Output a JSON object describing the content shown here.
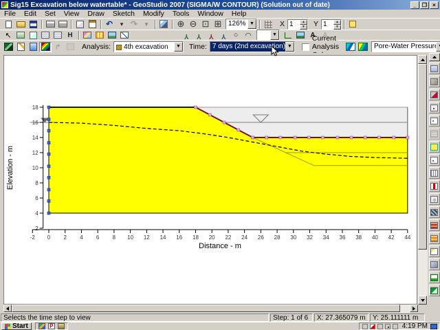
{
  "window": {
    "title": "Sig15  Excavation below watertable* - GeoStudio 2007 (SIGMA/W CONTOUR) (Solution out of date)",
    "minimize": "_",
    "restore": "❐",
    "close": "×"
  },
  "menu": [
    "File",
    "Edit",
    "Set",
    "View",
    "Draw",
    "Sketch",
    "Modify",
    "Tools",
    "Window",
    "Help"
  ],
  "toolbar_main": {
    "row1a": [
      "new",
      "open",
      "save",
      "|",
      "print",
      "print-preview",
      "|",
      "copy",
      "paste",
      "|",
      "undo",
      "undo-dropdown",
      "redo-disabled",
      "redo-dropdown-disabled",
      "|",
      "modify-objects",
      "|",
      "zoom-in",
      "zoom-out",
      "zoom-window",
      "zoom-page"
    ],
    "zoom_value": "126%",
    "row1b": [
      "grid"
    ],
    "x_label": "X",
    "x_value": "1",
    "y_label": "Y",
    "y_value": "1",
    "row1c": [
      "snap-grid"
    ]
  },
  "toolbar_edit": {
    "row2a": [
      "select",
      "select-picture",
      "copy-picture",
      "view-tables",
      "view-tables-2",
      "hatch-fill",
      "|",
      "draw-graph",
      "mesh-properties",
      "insert-picture",
      "view-result-graph"
    ],
    "row2b": [
      "draw-nodes",
      "draw-pins",
      "draw-fixity",
      "draw-loads",
      "draw-circle",
      "draw-arc"
    ],
    "row2c": [
      "sketch-axes",
      "modify-picture",
      "sketch-text",
      "sketch-text-edit-disabled"
    ]
  },
  "toolbar_analysis": {
    "row3a": [
      "geostudio-home",
      "define",
      "solve",
      "contour",
      "back-disabled",
      "delete-disabled"
    ],
    "analysis_label": "Analysis:",
    "analysis_value": "4th excavation",
    "time_label": "Time:",
    "time_value": "7 days (2nd excavation)",
    "checkbox_label": "Current Analysis Only",
    "row3b": [
      "draw-contours",
      "contour-labels"
    ],
    "parameter_value": "Pore-Water Pressure"
  },
  "chart_data": {
    "type": "area",
    "title": "",
    "xlabel": "Distance - m",
    "ylabel": "Elevation - m",
    "xlim": [
      -2,
      44
    ],
    "ylim": [
      2,
      18
    ],
    "x_ticks": [
      -2,
      0,
      2,
      4,
      6,
      8,
      10,
      12,
      14,
      16,
      18,
      20,
      22,
      24,
      26,
      28,
      30,
      32,
      34,
      36,
      38,
      40,
      42,
      44
    ],
    "y_ticks": [
      2,
      4,
      6,
      8,
      10,
      12,
      14,
      16,
      18
    ],
    "soil_region": [
      [
        0,
        4
      ],
      [
        0,
        18
      ],
      [
        18,
        18
      ],
      [
        25,
        14
      ],
      [
        44,
        14
      ],
      [
        44,
        4
      ]
    ],
    "excavated_region": [
      [
        18,
        18
      ],
      [
        44,
        18
      ],
      [
        44,
        14
      ],
      [
        25,
        14
      ]
    ],
    "ground_line": [
      [
        0,
        18
      ],
      [
        18,
        18
      ]
    ],
    "slope_line": [
      [
        18,
        18
      ],
      [
        25,
        14
      ]
    ],
    "base_line": [
      [
        25,
        14
      ],
      [
        44,
        14
      ]
    ],
    "future_excavation_lines": [
      [
        [
          25,
          14
        ],
        [
          32.5,
          10.3
        ]
      ],
      [
        [
          29,
          12
        ],
        [
          44,
          12
        ]
      ],
      [
        [
          32.5,
          10.3
        ],
        [
          44,
          10.3
        ]
      ]
    ],
    "initial_water_line": [
      [
        -2.3,
        16
      ],
      [
        0.7,
        16
      ]
    ],
    "water_table_dashed": [
      [
        0,
        16
      ],
      [
        4,
        15.9
      ],
      [
        8,
        15.6
      ],
      [
        12,
        15.2
      ],
      [
        16,
        14.9
      ],
      [
        19,
        14.5
      ],
      [
        22,
        14
      ],
      [
        25,
        13.4
      ],
      [
        28,
        12.8
      ],
      [
        31,
        12.2
      ],
      [
        34,
        11.8
      ],
      [
        37,
        11.5
      ],
      [
        40,
        11.35
      ],
      [
        44,
        11.25
      ]
    ],
    "excavation_water_line": [
      [
        21.5,
        16
      ],
      [
        44,
        16
      ]
    ],
    "water_symbols": [
      {
        "x": -0.5,
        "y": 16,
        "w": 10,
        "h": 6,
        "filled": true
      },
      {
        "x": 26,
        "y": 16,
        "w": 22,
        "h": 11,
        "filled": false
      }
    ],
    "left_boundary_markers": {
      "x": 0,
      "elevations": [
        4,
        5.6,
        7.1,
        8.7,
        10.2,
        11.8,
        13.3,
        14.9,
        16.4,
        18
      ]
    },
    "slope_markers": [
      [
        18,
        18
      ],
      [
        19.75,
        17
      ],
      [
        21.5,
        16
      ],
      [
        23.25,
        15
      ],
      [
        25,
        14
      ]
    ],
    "base_markers_y": 14,
    "base_markers_x": [
      25,
      26.7,
      28.4,
      30.2,
      31.9,
      33.6,
      35.4,
      37.1,
      38.8,
      40.5,
      42.3,
      44
    ],
    "colors": {
      "soil": "#ffff00",
      "excavated": "#ededed",
      "ground": "#1a1a1a",
      "excavation": "#6b1515",
      "future": "#9a9a00",
      "water": "#808080",
      "dashed": "#000000",
      "node_blue": "#3a62c0",
      "node_pink": "#dfa8df",
      "axis": "#000000",
      "tick_label": "#333333"
    }
  },
  "side_toolbar": [
    "sketch-font",
    "region-properties",
    "region-pencil",
    "node-properties",
    "node-numbers",
    "mesh-disabled",
    "draw-region",
    "point-colors",
    "draw-lines",
    "hydraulic-bc",
    "stress-bc",
    "mesh-red",
    "mesh-orange",
    "new-sketch",
    "sketch-zoom",
    "sketch-axes-right",
    "apply-changes",
    "save-green"
  ],
  "status_bar": {
    "message": "Selects the time step to view",
    "step": "Step: 1 of 6",
    "x": "X: 27.365079 m",
    "y": "Y: 25.111111 m"
  },
  "taskbar": {
    "start_label": "Start",
    "quick_p": "P",
    "time": "4:19 PM"
  }
}
